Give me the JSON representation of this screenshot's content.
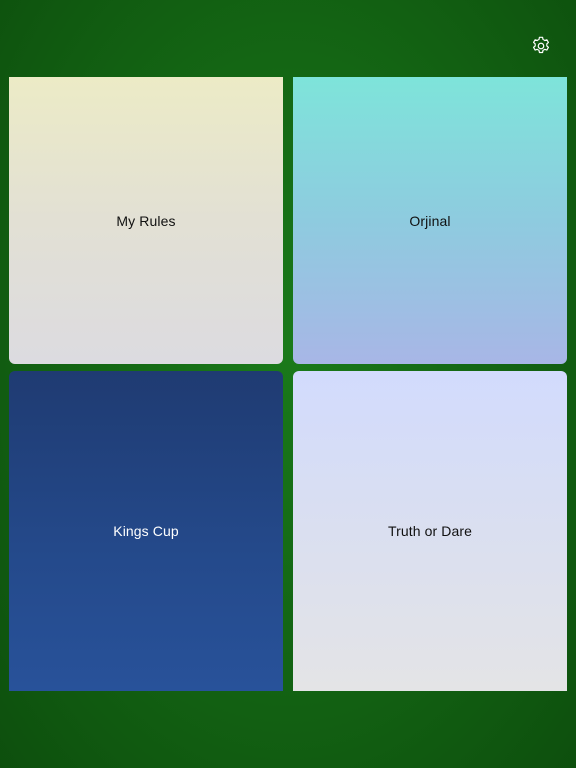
{
  "header": {
    "settings_icon": "gear-icon"
  },
  "tiles": [
    {
      "id": "my-rules",
      "label": "My Rules"
    },
    {
      "id": "orjinal",
      "label": "Orjinal"
    },
    {
      "id": "kings-cup",
      "label": "Kings Cup"
    },
    {
      "id": "truth-or-dare",
      "label": "Truth or Dare"
    }
  ],
  "colors": {
    "background": "#136313",
    "my_rules_top": "#ecebc6",
    "my_rules_bottom": "#dcdbe0",
    "orjinal_top": "#7ee4da",
    "orjinal_bottom": "#a8b6e6",
    "kings_cup_top": "#1f3b72",
    "kings_cup_bottom": "#28529a",
    "truth_or_dare_top": "#d2dbfd",
    "truth_or_dare_bottom": "#e4e4e6"
  }
}
